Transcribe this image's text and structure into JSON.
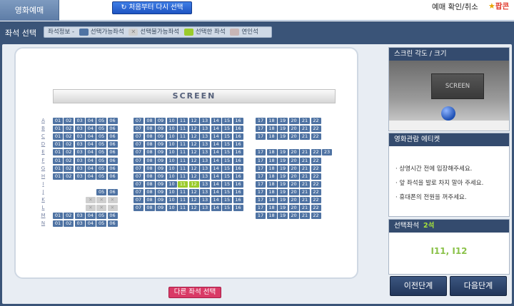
{
  "header": {
    "tab_label": "영화예매",
    "restart_label": "처음부터 다시 선택",
    "confirm_label": "예매 확인/취소",
    "logo_text": "팝콘"
  },
  "seat_bar": {
    "title": "좌석 선택",
    "legend_title": "좌석정보 -",
    "legend": [
      {
        "label": "선택가능좌석",
        "color": "#4f73a3"
      },
      {
        "label": "선택불가능좌석",
        "color": "#cfcfcf"
      },
      {
        "label": "선택한 좌석",
        "color": "#9acb2c"
      },
      {
        "label": "연인석",
        "color": "#c8b6b6"
      }
    ]
  },
  "seat_map": {
    "screen_label": "SCREEN",
    "rows": [
      "A",
      "B",
      "C",
      "D",
      "E",
      "F",
      "G",
      "H",
      "I",
      "J",
      "K",
      "L",
      "M",
      "N"
    ],
    "selected": [
      "I11",
      "I12"
    ],
    "unavailable_seats": [
      "K04",
      "K05",
      "K06",
      "L04",
      "L05",
      "L06"
    ],
    "other_seat_button": "다른 좌석 선택"
  },
  "side": {
    "view_title": "스크린 각도 / 크기",
    "view_screen_label": "SCREEN",
    "etiquette_title": "영화관람 에티켓",
    "etiquette": [
      "· 상영시간 전에 입장해주세요.",
      "· 앞 좌석을 발로 차지 말아 주세요.",
      "· 휴대폰의 전원을 꺼주세요."
    ],
    "selected_title": "선택좌석",
    "selected_count": "2석",
    "selected_seats": "I11, I12"
  },
  "nav": {
    "prev_label": "이전단계",
    "next_label": "다음단계"
  }
}
